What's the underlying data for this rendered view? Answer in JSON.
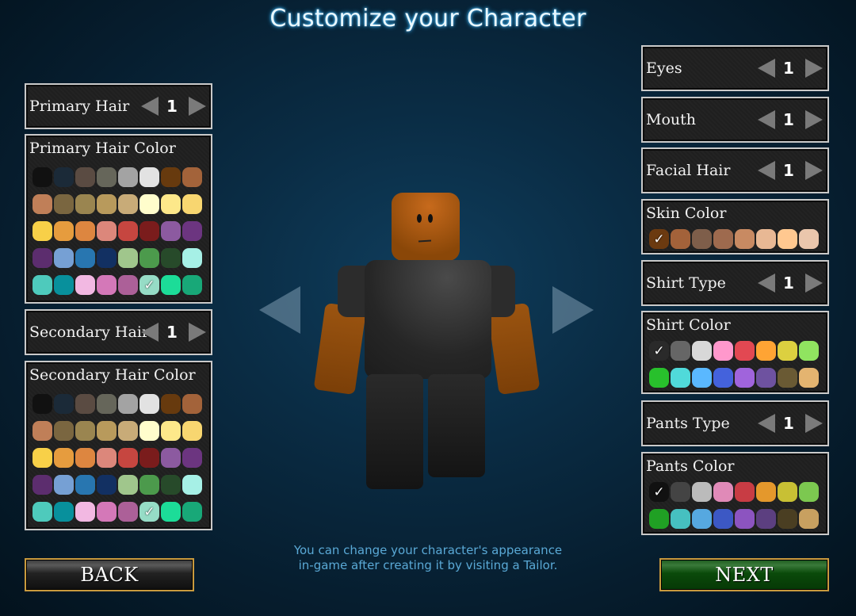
{
  "title": "Customize your Character",
  "left": {
    "primary_hair": {
      "label": "Primary Hair",
      "value": "1"
    },
    "primary_hair_color": {
      "label": "Primary Hair Color",
      "selected_index": 37,
      "colors": [
        "#111111",
        "#1b2a38",
        "#5a4b42",
        "#66665a",
        "#a3a3a3",
        "#e2e2e2",
        "#673a0e",
        "#a3633a",
        "#c07f58",
        "#7a6640",
        "#9a8550",
        "#b89a5c",
        "#c8ab78",
        "#fffdcc",
        "#fde88a",
        "#f8d670",
        "#f8d048",
        "#e69c3e",
        "#dd8640",
        "#dc877b",
        "#c64640",
        "#7a1c1c",
        "#8c5aa0",
        "#6c3580",
        "#5c2d6e",
        "#76a0d4",
        "#2876b0",
        "#123062",
        "#a0c68c",
        "#4c9a4c",
        "#274a2a",
        "#a6f0e6",
        "#4ecabc",
        "#08909c",
        "#f2b8e2",
        "#d478b8",
        "#ac6098",
        "#96dcc6",
        "#1cdc98",
        "#18a878"
      ]
    },
    "secondary_hair": {
      "label": "Secondary Hair",
      "value": "1"
    },
    "secondary_hair_color": {
      "label": "Secondary Hair Color",
      "selected_index": 37,
      "colors": [
        "#111111",
        "#1b2a38",
        "#5a4b42",
        "#66665a",
        "#a3a3a3",
        "#e2e2e2",
        "#673a0e",
        "#a3633a",
        "#c07f58",
        "#7a6640",
        "#9a8550",
        "#b89a5c",
        "#c8ab78",
        "#fffdcc",
        "#fde88a",
        "#f8d670",
        "#f8d048",
        "#e69c3e",
        "#dd8640",
        "#dc877b",
        "#c64640",
        "#7a1c1c",
        "#8c5aa0",
        "#6c3580",
        "#5c2d6e",
        "#76a0d4",
        "#2876b0",
        "#123062",
        "#a0c68c",
        "#4c9a4c",
        "#274a2a",
        "#a6f0e6",
        "#4ecabc",
        "#08909c",
        "#f2b8e2",
        "#d478b8",
        "#ac6098",
        "#96dcc6",
        "#1cdc98",
        "#18a878"
      ]
    }
  },
  "right": {
    "eyes": {
      "label": "Eyes",
      "value": "1"
    },
    "mouth": {
      "label": "Mouth",
      "value": "1"
    },
    "facial_hair": {
      "label": "Facial Hair",
      "value": "1"
    },
    "skin_color": {
      "label": "Skin Color",
      "selected_index": 0,
      "colors": [
        "#6b3a10",
        "#a3623a",
        "#7e5e4a",
        "#9e6a4e",
        "#c88a62",
        "#e8b894",
        "#ffc890",
        "#eac6ac"
      ]
    },
    "shirt_type": {
      "label": "Shirt Type",
      "value": "1"
    },
    "shirt_color": {
      "label": "Shirt Color",
      "selected_index": 0,
      "colors": [
        "#2a2a2a",
        "#666666",
        "#d8d8d8",
        "#ff98cc",
        "#e24852",
        "#ffa434",
        "#dcd040",
        "#90e460",
        "#28c02c",
        "#50dada",
        "#5ab8ff",
        "#4462dc",
        "#a064dc",
        "#6e52a0",
        "#6a5a34",
        "#e4b470"
      ]
    },
    "pants_type": {
      "label": "Pants Type",
      "value": "1"
    },
    "pants_color": {
      "label": "Pants Color",
      "selected_index": 0,
      "colors": [
        "#111111",
        "#444444",
        "#bbbbbb",
        "#e08ab8",
        "#c83c44",
        "#e4982c",
        "#c8c034",
        "#7cc850",
        "#20a024",
        "#46c0c0",
        "#56a8e0",
        "#3c58c4",
        "#8c54c0",
        "#5c3f80",
        "#4a3e22",
        "#c8a060"
      ]
    }
  },
  "hint": [
    "You can change your character's appearance",
    "in-game after creating it by visiting a Tailor."
  ],
  "buttons": {
    "back": "BACK",
    "next": "NEXT"
  },
  "icons": {
    "check": "✓"
  }
}
